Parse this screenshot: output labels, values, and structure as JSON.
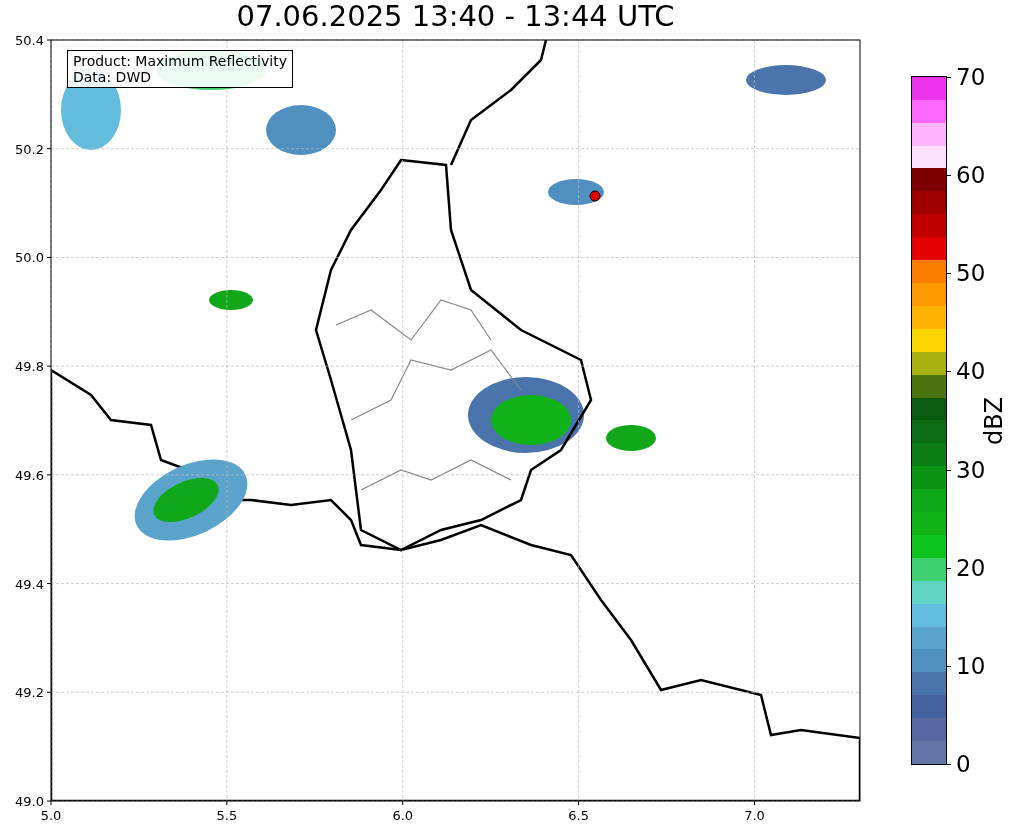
{
  "title": "07.06.2025 13:40 - 13:44 UTC",
  "map": {
    "info_lines": [
      "Product: Maximum Reflectivity",
      "Data: DWD"
    ],
    "xticks": [
      "5.0",
      "5.5",
      "6.0",
      "6.5",
      "7.0"
    ],
    "yticks": [
      "50.4",
      "50.2",
      "50.0",
      "49.8",
      "49.6",
      "49.4",
      "49.2",
      "49.0"
    ]
  },
  "colorbar": {
    "label": "dBZ",
    "ticks": [
      "70",
      "60",
      "50",
      "40",
      "30",
      "20",
      "10",
      "0"
    ],
    "bins": [
      {
        "color": "#6276a6"
      },
      {
        "color": "#5668a0"
      },
      {
        "color": "#45609f"
      },
      {
        "color": "#4a74ab"
      },
      {
        "color": "#5090c0"
      },
      {
        "color": "#5aa4cc"
      },
      {
        "color": "#64bcdc"
      },
      {
        "color": "#60d4c4"
      },
      {
        "color": "#40d070"
      },
      {
        "color": "#10c420"
      },
      {
        "color": "#10b418"
      },
      {
        "color": "#10a818"
      },
      {
        "color": "#0c9414"
      },
      {
        "color": "#0c7c14"
      },
      {
        "color": "#0c6c14"
      },
      {
        "color": "#0a5a12"
      },
      {
        "color": "#4a7410"
      },
      {
        "color": "#aab010"
      },
      {
        "color": "#fcd400"
      },
      {
        "color": "#fcb400"
      },
      {
        "color": "#fc9800"
      },
      {
        "color": "#fc7c00"
      },
      {
        "color": "#e40000"
      },
      {
        "color": "#c00000"
      },
      {
        "color": "#a00000"
      },
      {
        "color": "#7c0000"
      },
      {
        "color": "#ffe0ff"
      },
      {
        "color": "#ffb4ff"
      },
      {
        "color": "#fc68fc"
      },
      {
        "color": "#ec34ec"
      }
    ]
  }
}
